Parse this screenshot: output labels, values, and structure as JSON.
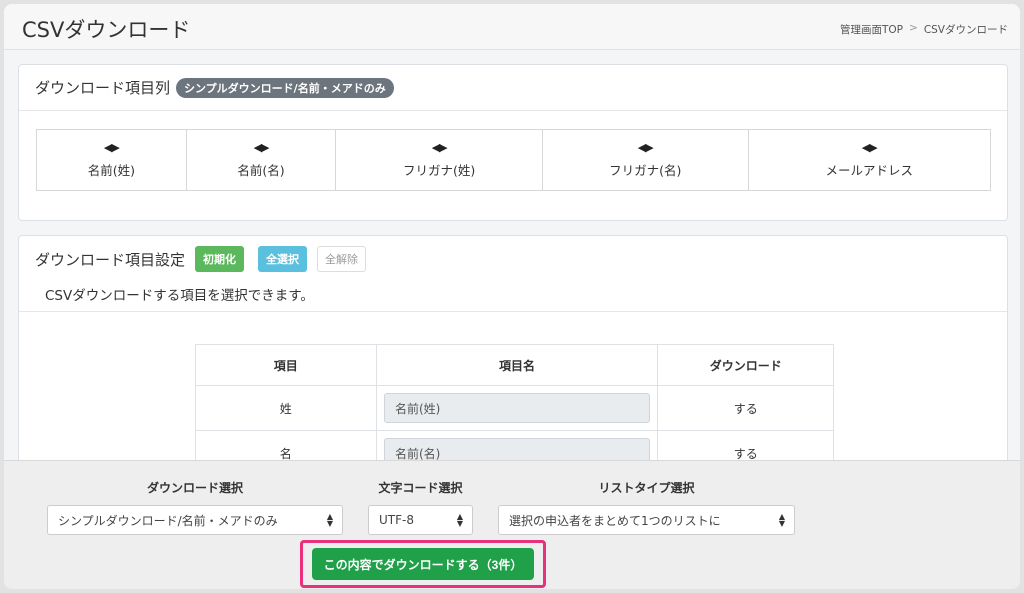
{
  "header": {
    "title": "CSVダウンロード",
    "breadcrumb": {
      "home": "管理画面TOP",
      "separator": ">",
      "current": "CSVダウンロード"
    }
  },
  "columns_card": {
    "title": "ダウンロード項目列",
    "badge": "シンプルダウンロード/名前・メアドのみ",
    "columns": [
      "名前(姓)",
      "名前(名)",
      "フリガナ(姓)",
      "フリガナ(名)",
      "メールアドレス"
    ],
    "drag_icon": "left-right-arrows-icon",
    "drag_glyph": "◀▶"
  },
  "settings_card": {
    "title": "ダウンロード項目設定",
    "btn_reset": "初期化",
    "btn_select_all": "全選択",
    "btn_deselect_all": "全解除",
    "description": "CSVダウンロードする項目を選択できます。",
    "table_headers": [
      "項目",
      "項目名",
      "ダウンロード"
    ],
    "rows": [
      {
        "item": "姓",
        "name": "名前(姓)",
        "download": "する"
      },
      {
        "item": "名",
        "name": "名前(名)",
        "download": "する"
      }
    ]
  },
  "footer": {
    "download_select_label": "ダウンロード選択",
    "download_select_value": "シンプルダウンロード/名前・メアドのみ",
    "encoding_label": "文字コード選択",
    "encoding_value": "UTF-8",
    "list_type_label": "リストタイプ選択",
    "list_type_value": "選択の申込者をまとめて1つのリストに",
    "download_button": "この内容でダウンロードする（3件）"
  },
  "colors": {
    "primary_green": "#21a04a",
    "highlight_pink": "#e8317a",
    "badge_gray": "#6c757d"
  }
}
